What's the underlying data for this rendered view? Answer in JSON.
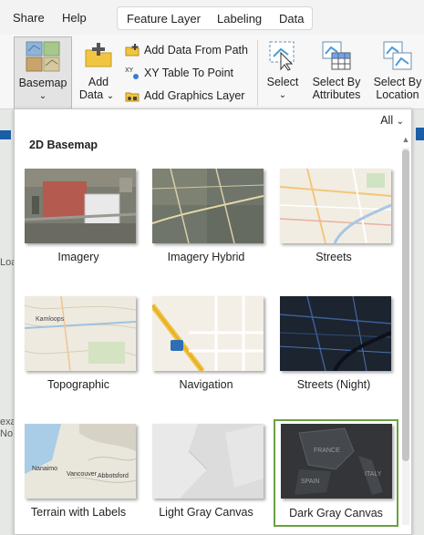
{
  "menu": {
    "share": "Share",
    "help": "Help"
  },
  "context_tabs": [
    "Feature Layer",
    "Labeling",
    "Data"
  ],
  "ribbon": {
    "basemap_label": "Basemap",
    "add_data_label_1": "Add",
    "add_data_label_2": "Data",
    "add_data_from_path": "Add Data From Path",
    "xy_table_to_point": "XY Table To Point",
    "add_graphics_layer": "Add Graphics Layer",
    "select_label": "Select",
    "select_by_attributes_1": "Select By",
    "select_by_attributes_2": "Attributes",
    "select_by_location_1": "Select By",
    "select_by_location_2": "Location",
    "chevron": "⌄"
  },
  "gallery": {
    "filter_value": "All",
    "section_title": "2D Basemap",
    "tiles": [
      {
        "label": "Imagery",
        "selected": false
      },
      {
        "label": "Imagery Hybrid",
        "selected": false
      },
      {
        "label": "Streets",
        "selected": false
      },
      {
        "label": "Topographic",
        "selected": false
      },
      {
        "label": "Navigation",
        "selected": false
      },
      {
        "label": "Streets (Night)",
        "selected": false
      },
      {
        "label": "Terrain with Labels",
        "selected": false
      },
      {
        "label": "Light Gray Canvas",
        "selected": false
      },
      {
        "label": "Dark Gray Canvas",
        "selected": true
      }
    ],
    "thumb_labels": {
      "topo_place": "Kamloops",
      "terrain_place_1": "Nanaimo",
      "terrain_place_2": "Vancouver",
      "terrain_place_3": "Abbotsford",
      "dark_place_1": "FRANCE",
      "dark_place_2": "SPAIN",
      "dark_place_3": "ITALY"
    }
  },
  "background_fragments": {
    "left_1": "Loa",
    "left_2": "exa",
    "left_3": "No"
  },
  "colors": {
    "selected_border": "#6aa041",
    "accent_blue": "#1a5ea8"
  }
}
